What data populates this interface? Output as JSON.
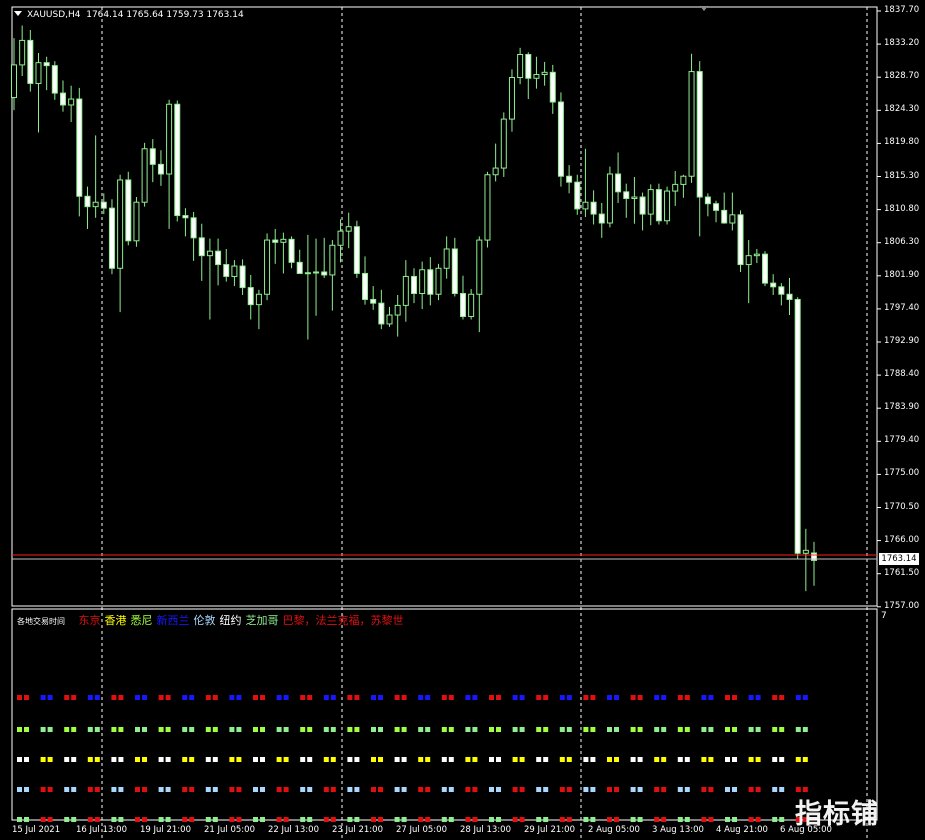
{
  "chart": {
    "symbol_label": "XAUUSD,H4",
    "ohlc_label": "1764.14 1765.64 1759.73 1763.14",
    "current_price_label": "1763.14",
    "subwindow_scale_label": "7",
    "watermark_text": "指标铺"
  },
  "legend": {
    "title": "各地交易时间",
    "items": [
      {
        "label": "东京",
        "color": "#e01010"
      },
      {
        "label": "香港",
        "color": "#ffff00"
      },
      {
        "label": "悉尼",
        "color": "#a0ff40"
      },
      {
        "label": "新西兰",
        "color": "#1818ff"
      },
      {
        "label": "伦敦",
        "color": "#a8d8ff"
      },
      {
        "label": "纽约",
        "color": "#ffffff"
      },
      {
        "label": "芝加哥",
        "color": "#90ee90"
      },
      {
        "label": "巴黎，法兰克福，苏黎世",
        "color": "#e01010"
      }
    ]
  },
  "price_axis": [
    "1837.70",
    "1833.20",
    "1828.70",
    "1824.30",
    "1819.80",
    "1815.30",
    "1810.80",
    "1806.30",
    "1801.90",
    "1797.40",
    "1792.90",
    "1788.40",
    "1783.90",
    "1779.40",
    "1775.00",
    "1770.50",
    "1766.00",
    "1761.50",
    "1757.00"
  ],
  "time_axis": [
    "15 Jul 2021",
    "16 Jul 13:00",
    "19 Jul 21:00",
    "21 Jul 05:00",
    "22 Jul 13:00",
    "23 Jul 21:00",
    "27 Jul 05:00",
    "28 Jul 13:00",
    "29 Jul 21:00",
    "2 Aug 05:00",
    "3 Aug 13:00",
    "4 Aug 21:00",
    "6 Aug 05:00"
  ],
  "colors": {
    "bull_body": "#000000",
    "bear_body": "#ffffff",
    "candle_outline": "#90ee90",
    "wick": "#90ee90",
    "bid_line": "#ff2020",
    "ask_line": "#c0c0c0",
    "grid": "#ffffff",
    "session_rows": [
      "#e01010",
      "#a0ff40",
      "#ffffff",
      "#a8d8ff",
      "#90ee90"
    ],
    "session_alt": [
      "#1818ff",
      "#90ee90",
      "#ffff00",
      "#e01010",
      "#e01010"
    ]
  },
  "chart_data": {
    "type": "candlestick",
    "ylim": [
      1757.0,
      1837.7
    ],
    "candles": [
      {
        "o": 1825.5,
        "h": 1833.5,
        "l": 1823.8,
        "c": 1829.9
      },
      {
        "o": 1829.9,
        "h": 1835.2,
        "l": 1828.4,
        "c": 1833.2
      },
      {
        "o": 1833.2,
        "h": 1834.6,
        "l": 1826.3,
        "c": 1827.4
      },
      {
        "o": 1827.4,
        "h": 1831.5,
        "l": 1820.8,
        "c": 1830.2
      },
      {
        "o": 1830.2,
        "h": 1831.0,
        "l": 1826.5,
        "c": 1829.8
      },
      {
        "o": 1829.8,
        "h": 1830.4,
        "l": 1825.2,
        "c": 1826.1
      },
      {
        "o": 1826.1,
        "h": 1827.8,
        "l": 1823.6,
        "c": 1824.5
      },
      {
        "o": 1824.5,
        "h": 1827.1,
        "l": 1822.2,
        "c": 1825.3
      },
      {
        "o": 1825.3,
        "h": 1826.8,
        "l": 1809.5,
        "c": 1812.2
      },
      {
        "o": 1812.2,
        "h": 1813.5,
        "l": 1807.8,
        "c": 1810.8
      },
      {
        "o": 1810.8,
        "h": 1820.4,
        "l": 1809.3,
        "c": 1811.4
      },
      {
        "o": 1811.4,
        "h": 1812.6,
        "l": 1809.8,
        "c": 1810.6
      },
      {
        "o": 1810.6,
        "h": 1811.8,
        "l": 1801.7,
        "c": 1802.5
      },
      {
        "o": 1802.5,
        "h": 1815.1,
        "l": 1796.6,
        "c": 1814.4
      },
      {
        "o": 1814.4,
        "h": 1815.5,
        "l": 1805.6,
        "c": 1806.2
      },
      {
        "o": 1806.2,
        "h": 1812.1,
        "l": 1805.4,
        "c": 1811.4
      },
      {
        "o": 1811.4,
        "h": 1819.4,
        "l": 1810.8,
        "c": 1818.6
      },
      {
        "o": 1818.6,
        "h": 1819.9,
        "l": 1814.1,
        "c": 1816.5
      },
      {
        "o": 1816.5,
        "h": 1818.4,
        "l": 1813.6,
        "c": 1815.2
      },
      {
        "o": 1815.2,
        "h": 1825.2,
        "l": 1807.8,
        "c": 1824.6
      },
      {
        "o": 1824.6,
        "h": 1825.1,
        "l": 1808.8,
        "c": 1809.6
      },
      {
        "o": 1809.6,
        "h": 1810.6,
        "l": 1806.8,
        "c": 1809.3
      },
      {
        "o": 1809.3,
        "h": 1810.1,
        "l": 1803.5,
        "c": 1806.6
      },
      {
        "o": 1806.6,
        "h": 1808.5,
        "l": 1800.8,
        "c": 1804.2
      },
      {
        "o": 1804.2,
        "h": 1806.5,
        "l": 1795.6,
        "c": 1804.8
      },
      {
        "o": 1804.8,
        "h": 1806.5,
        "l": 1800.2,
        "c": 1803.0
      },
      {
        "o": 1803.0,
        "h": 1805.1,
        "l": 1800.7,
        "c": 1801.4
      },
      {
        "o": 1801.4,
        "h": 1803.6,
        "l": 1800.1,
        "c": 1802.8
      },
      {
        "o": 1802.8,
        "h": 1803.7,
        "l": 1798.9,
        "c": 1799.9
      },
      {
        "o": 1799.9,
        "h": 1801.6,
        "l": 1795.6,
        "c": 1797.6
      },
      {
        "o": 1797.6,
        "h": 1799.6,
        "l": 1794.3,
        "c": 1799.0
      },
      {
        "o": 1799.0,
        "h": 1807.2,
        "l": 1798.2,
        "c": 1806.3
      },
      {
        "o": 1806.3,
        "h": 1807.8,
        "l": 1803.1,
        "c": 1806.0
      },
      {
        "o": 1806.0,
        "h": 1807.3,
        "l": 1801.8,
        "c": 1806.4
      },
      {
        "o": 1806.4,
        "h": 1806.8,
        "l": 1802.5,
        "c": 1803.3
      },
      {
        "o": 1803.3,
        "h": 1805.0,
        "l": 1801.9,
        "c": 1801.8
      },
      {
        "o": 1801.8,
        "h": 1807.0,
        "l": 1792.9,
        "c": 1801.9
      },
      {
        "o": 1801.9,
        "h": 1806.5,
        "l": 1796.1,
        "c": 1802.0
      },
      {
        "o": 1802.0,
        "h": 1806.6,
        "l": 1801.2,
        "c": 1801.6
      },
      {
        "o": 1801.6,
        "h": 1806.3,
        "l": 1796.8,
        "c": 1805.6
      },
      {
        "o": 1805.6,
        "h": 1809.1,
        "l": 1803.3,
        "c": 1807.5
      },
      {
        "o": 1807.5,
        "h": 1810.0,
        "l": 1805.2,
        "c": 1808.1
      },
      {
        "o": 1808.1,
        "h": 1808.9,
        "l": 1801.2,
        "c": 1801.8
      },
      {
        "o": 1801.8,
        "h": 1804.1,
        "l": 1797.6,
        "c": 1798.3
      },
      {
        "o": 1798.3,
        "h": 1800.1,
        "l": 1796.9,
        "c": 1797.8
      },
      {
        "o": 1797.8,
        "h": 1799.6,
        "l": 1794.3,
        "c": 1795.0
      },
      {
        "o": 1795.0,
        "h": 1797.3,
        "l": 1794.6,
        "c": 1796.2
      },
      {
        "o": 1796.2,
        "h": 1798.9,
        "l": 1793.3,
        "c": 1797.5
      },
      {
        "o": 1797.5,
        "h": 1803.6,
        "l": 1795.3,
        "c": 1801.4
      },
      {
        "o": 1801.4,
        "h": 1802.5,
        "l": 1797.8,
        "c": 1799.1
      },
      {
        "o": 1799.1,
        "h": 1803.4,
        "l": 1797.0,
        "c": 1802.3
      },
      {
        "o": 1802.3,
        "h": 1804.0,
        "l": 1797.5,
        "c": 1799.0
      },
      {
        "o": 1799.0,
        "h": 1803.1,
        "l": 1798.2,
        "c": 1802.5
      },
      {
        "o": 1802.5,
        "h": 1806.8,
        "l": 1801.1,
        "c": 1805.1
      },
      {
        "o": 1805.1,
        "h": 1806.6,
        "l": 1798.7,
        "c": 1799.1
      },
      {
        "o": 1799.1,
        "h": 1801.5,
        "l": 1795.6,
        "c": 1796.0
      },
      {
        "o": 1796.0,
        "h": 1799.7,
        "l": 1795.6,
        "c": 1799.0
      },
      {
        "o": 1799.0,
        "h": 1806.8,
        "l": 1793.9,
        "c": 1806.3
      },
      {
        "o": 1806.3,
        "h": 1815.5,
        "l": 1805.3,
        "c": 1815.1
      },
      {
        "o": 1815.1,
        "h": 1819.3,
        "l": 1814.2,
        "c": 1816.0
      },
      {
        "o": 1816.0,
        "h": 1823.5,
        "l": 1814.8,
        "c": 1822.6
      },
      {
        "o": 1822.6,
        "h": 1829.3,
        "l": 1820.9,
        "c": 1828.2
      },
      {
        "o": 1828.2,
        "h": 1832.2,
        "l": 1827.3,
        "c": 1831.3
      },
      {
        "o": 1831.3,
        "h": 1831.6,
        "l": 1825.3,
        "c": 1828.1
      },
      {
        "o": 1828.1,
        "h": 1831.0,
        "l": 1826.7,
        "c": 1828.6
      },
      {
        "o": 1828.6,
        "h": 1830.3,
        "l": 1827.1,
        "c": 1828.9
      },
      {
        "o": 1828.9,
        "h": 1829.9,
        "l": 1823.3,
        "c": 1824.9
      },
      {
        "o": 1824.9,
        "h": 1826.2,
        "l": 1813.5,
        "c": 1814.9
      },
      {
        "o": 1814.9,
        "h": 1816.4,
        "l": 1812.6,
        "c": 1814.1
      },
      {
        "o": 1814.1,
        "h": 1815.1,
        "l": 1809.7,
        "c": 1810.5
      },
      {
        "o": 1810.5,
        "h": 1818.6,
        "l": 1809.4,
        "c": 1811.4
      },
      {
        "o": 1811.4,
        "h": 1813.0,
        "l": 1808.4,
        "c": 1809.8
      },
      {
        "o": 1809.8,
        "h": 1811.3,
        "l": 1806.6,
        "c": 1808.6
      },
      {
        "o": 1808.6,
        "h": 1816.2,
        "l": 1808.0,
        "c": 1815.2
      },
      {
        "o": 1815.2,
        "h": 1818.1,
        "l": 1811.3,
        "c": 1812.8
      },
      {
        "o": 1812.8,
        "h": 1813.9,
        "l": 1809.3,
        "c": 1811.9
      },
      {
        "o": 1811.9,
        "h": 1814.8,
        "l": 1808.5,
        "c": 1812.1
      },
      {
        "o": 1812.1,
        "h": 1812.7,
        "l": 1807.6,
        "c": 1809.8
      },
      {
        "o": 1809.8,
        "h": 1813.8,
        "l": 1808.3,
        "c": 1813.1
      },
      {
        "o": 1813.1,
        "h": 1813.9,
        "l": 1808.4,
        "c": 1808.9
      },
      {
        "o": 1808.9,
        "h": 1813.5,
        "l": 1808.4,
        "c": 1812.9
      },
      {
        "o": 1812.9,
        "h": 1815.6,
        "l": 1810.9,
        "c": 1813.8
      },
      {
        "o": 1813.8,
        "h": 1815.1,
        "l": 1812.0,
        "c": 1814.9
      },
      {
        "o": 1814.9,
        "h": 1831.4,
        "l": 1814.0,
        "c": 1829.0
      },
      {
        "o": 1829.0,
        "h": 1830.4,
        "l": 1806.8,
        "c": 1812.1
      },
      {
        "o": 1812.1,
        "h": 1812.6,
        "l": 1809.5,
        "c": 1811.2
      },
      {
        "o": 1811.2,
        "h": 1811.6,
        "l": 1808.7,
        "c": 1810.3
      },
      {
        "o": 1810.3,
        "h": 1812.7,
        "l": 1808.5,
        "c": 1808.6
      },
      {
        "o": 1808.6,
        "h": 1812.7,
        "l": 1807.6,
        "c": 1809.7
      },
      {
        "o": 1809.7,
        "h": 1810.3,
        "l": 1802.0,
        "c": 1803.0
      },
      {
        "o": 1803.0,
        "h": 1806.3,
        "l": 1797.8,
        "c": 1804.2
      },
      {
        "o": 1804.2,
        "h": 1805.1,
        "l": 1803.2,
        "c": 1804.4
      },
      {
        "o": 1804.4,
        "h": 1804.8,
        "l": 1800.1,
        "c": 1800.5
      },
      {
        "o": 1800.5,
        "h": 1801.7,
        "l": 1798.9,
        "c": 1800.0
      },
      {
        "o": 1800.0,
        "h": 1800.5,
        "l": 1797.5,
        "c": 1799.0
      },
      {
        "o": 1799.0,
        "h": 1801.2,
        "l": 1796.2,
        "c": 1798.3
      },
      {
        "o": 1798.3,
        "h": 1798.6,
        "l": 1763.3,
        "c": 1764.1
      },
      {
        "o": 1764.1,
        "h": 1767.4,
        "l": 1759.0,
        "c": 1764.5
      },
      {
        "o": 1764.14,
        "h": 1765.64,
        "l": 1759.73,
        "c": 1763.14
      }
    ]
  }
}
